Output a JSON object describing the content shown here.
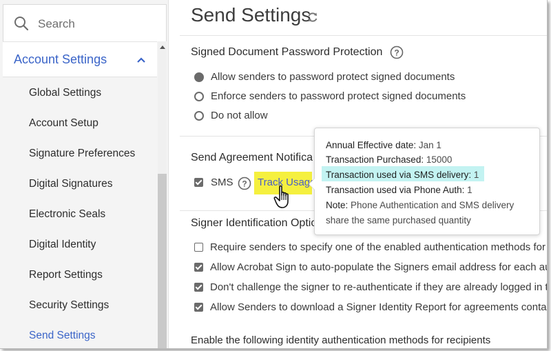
{
  "sidebar": {
    "search_placeholder": "Search",
    "section_label": "Account Settings",
    "items": [
      {
        "label": "Global Settings"
      },
      {
        "label": "Account Setup"
      },
      {
        "label": "Signature Preferences"
      },
      {
        "label": "Digital Signatures"
      },
      {
        "label": "Electronic Seals"
      },
      {
        "label": "Digital Identity"
      },
      {
        "label": "Report Settings"
      },
      {
        "label": "Security Settings"
      },
      {
        "label": "Send Settings",
        "active": true
      }
    ],
    "accent_color": "#3a64c8"
  },
  "main": {
    "title": "Send Settings",
    "password_section": {
      "title": "Signed Document Password Protection",
      "options": [
        {
          "label": "Allow senders to password protect signed documents",
          "selected": true
        },
        {
          "label": "Enforce senders to password protect signed documents",
          "selected": false
        },
        {
          "label": "Do not allow",
          "selected": false
        }
      ]
    },
    "notification_section": {
      "title": "Send Agreement Notifica",
      "sms_label": "SMS",
      "sms_checked": true,
      "track_usage_label": "Track Usage"
    },
    "signer_section": {
      "title": "Signer Identification Optio",
      "options": [
        {
          "label": "Require senders to specify one of the enabled authentication methods for re",
          "checked": false
        },
        {
          "label": "Allow Acrobat Sign to auto-populate the Signers email address for each auth",
          "checked": true
        },
        {
          "label": "Don't challenge the signer to re-authenticate if they are already logged in to",
          "checked": true
        },
        {
          "label": "Allow Senders to download a Signer Identity Report for agreements contain",
          "checked": true
        }
      ]
    },
    "footer_text": "Enable the following identity authentication methods for recipients"
  },
  "tooltip": {
    "lines": [
      {
        "key": "Annual Effective date",
        "sep": ": ",
        "value": "Jan 1"
      },
      {
        "key": "Transaction Purchased",
        "sep": ": ",
        "value": "15000"
      },
      {
        "key": "Transaction used via SMS delivery",
        "sep": ": ",
        "value": "1"
      },
      {
        "key": "Transaction used via Phone Auth",
        "sep": ": ",
        "value": "1"
      },
      {
        "key": "Note",
        "sep": ": ",
        "value": "Phone Authentication and SMS delivery"
      },
      {
        "key": "",
        "sep": "",
        "value": "share the same purchased quantity"
      }
    ],
    "highlight_color": "#c3f3f2"
  },
  "track_usage_highlight_color": "#f5f03f"
}
